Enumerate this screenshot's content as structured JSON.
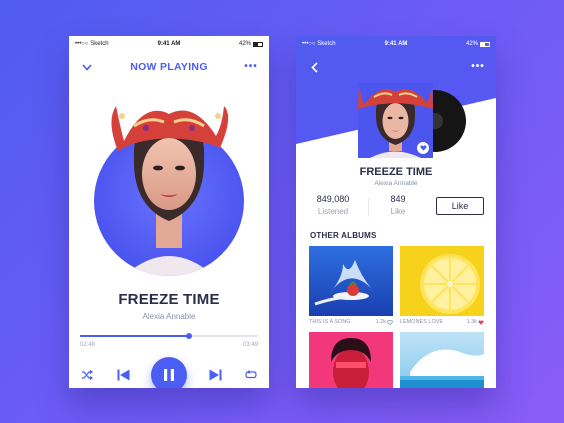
{
  "colors": {
    "accent": "#4a5ef4",
    "background_start": "#4f5cf0",
    "background_end": "#8a5cf7",
    "heart_red": "#e8455d",
    "text_dark": "#2b2e4a",
    "text_muted": "#8a8fa8"
  },
  "status_bar": {
    "carrier": "•••○○ Sketch",
    "time": "9:41 AM",
    "battery": "42%"
  },
  "now_playing": {
    "title": "NOW PLAYING",
    "song": "FREEZE TIME",
    "artist": "Alexia Annable",
    "elapsed": "02:48",
    "duration": "03:49",
    "progress": 0.61,
    "controls": [
      "shuffle-icon",
      "previous-icon",
      "pause-icon",
      "next-icon",
      "repeat-icon"
    ]
  },
  "album": {
    "title": "FREEZE TIME",
    "artist": "Alexia Annable",
    "listened_count": "849,080",
    "listened_label": "Listened",
    "like_count": "849",
    "like_label": "Like",
    "like_button": "Like"
  },
  "other_albums": {
    "heading": "OTHER ALBUMS",
    "items": [
      {
        "name": "THIS IS A SONG",
        "likes": "1.2k",
        "liked": false
      },
      {
        "name": "LEMONES LOVE",
        "likes": "1.3k",
        "liked": true
      },
      {
        "name": "",
        "likes": "",
        "liked": false
      },
      {
        "name": "",
        "likes": "",
        "liked": false
      }
    ]
  }
}
